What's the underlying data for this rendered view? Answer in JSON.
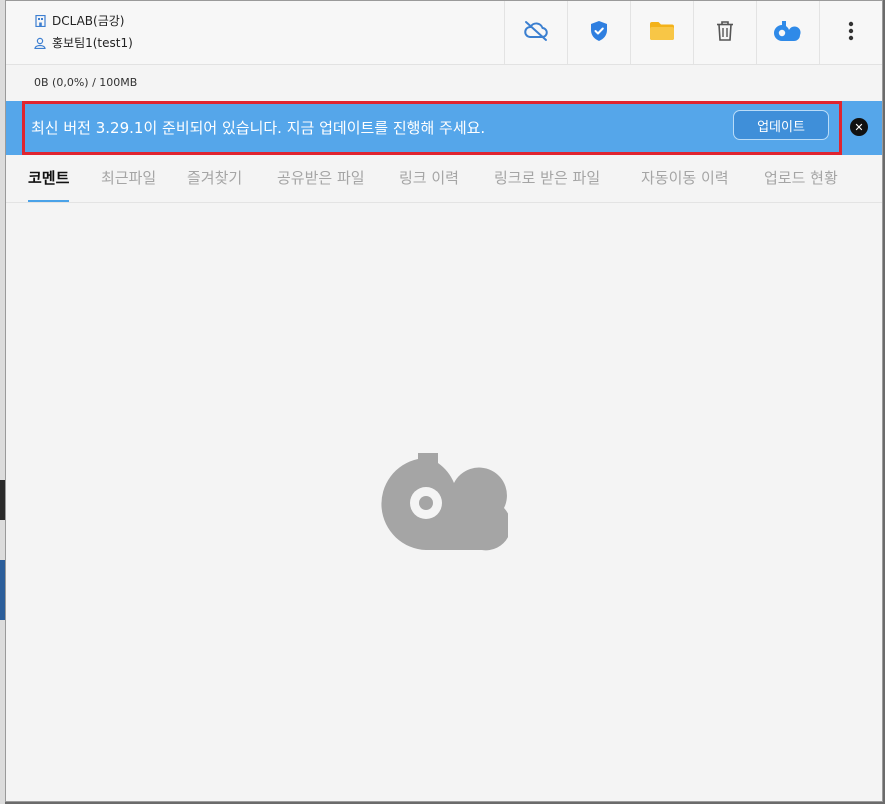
{
  "account": {
    "organization": "DCLAB(금강)",
    "user": "홍보팀1(test1)"
  },
  "toolbar": {
    "icons": [
      "cloud-off-icon",
      "shield-icon",
      "folder-icon",
      "trash-icon",
      "cloud-logo-icon",
      "more-vertical-icon"
    ]
  },
  "storage": {
    "usage": "0B (0,0%) / 100MB"
  },
  "banner": {
    "message": "최신 버전 3.29.1이 준비되어 있습니다. 지금 업데이트를 진행해 주세요.",
    "button_label": "업데이트",
    "close_symbol": "✕"
  },
  "tabs": [
    {
      "label": "코멘트",
      "active": true
    },
    {
      "label": "최근파일",
      "active": false
    },
    {
      "label": "즐겨찾기",
      "active": false
    },
    {
      "label": "공유받은 파일",
      "active": false
    },
    {
      "label": "링크 이력",
      "active": false
    },
    {
      "label": "링크로 받은 파일",
      "active": false
    },
    {
      "label": "자동이동 이력",
      "active": false
    },
    {
      "label": "업로드 현황",
      "active": false
    }
  ],
  "colors": {
    "banner": "#55a6ea",
    "banner_outline": "#e0242f",
    "accent": "#4aa2e8",
    "logo_gray": "#a5a5a5"
  }
}
